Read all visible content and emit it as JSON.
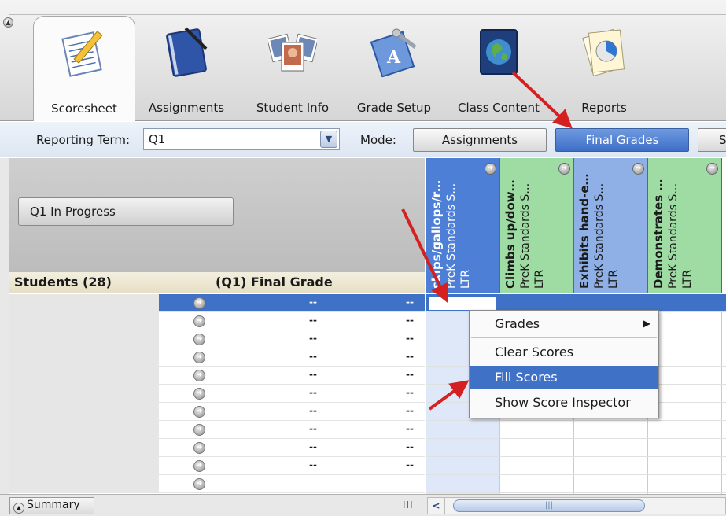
{
  "toolbar": {
    "tabs": [
      {
        "label": "Scoresheet",
        "icon": "scoresheet-icon",
        "active": true
      },
      {
        "label": "Assignments",
        "icon": "assignments-notebook-icon",
        "active": false
      },
      {
        "label": "Student Info",
        "icon": "student-photos-icon",
        "active": false
      },
      {
        "label": "Grade Setup",
        "icon": "grade-setup-icon",
        "active": false
      },
      {
        "label": "Class Content",
        "icon": "globe-book-icon",
        "active": false
      },
      {
        "label": "Reports",
        "icon": "pie-chart-report-icon",
        "active": false
      }
    ]
  },
  "reporting": {
    "label": "Reporting Term:",
    "term_value": "Q1",
    "mode_label": "Mode:",
    "mode_buttons": [
      "Assignments",
      "Final Grades",
      "S"
    ],
    "active_mode": "Final Grades"
  },
  "left_panel": {
    "progress_button": "Q1 In Progress",
    "students_header": "Students (28)",
    "final_grade_header": "(Q1) Final Grade",
    "row_dash": "--"
  },
  "columns": [
    {
      "title": "skips/gallops/r…",
      "subtitle": "PreK Standards S…",
      "type": "LTR",
      "color": "#4e7fd6"
    },
    {
      "title": "Climbs up/dow…",
      "subtitle": "PreK Standards S…",
      "type": "LTR",
      "color": "#9fdca4"
    },
    {
      "title": "Exhibits hand-e…",
      "subtitle": "PreK Standards S…",
      "type": "LTR",
      "color": "#8fb0e6"
    },
    {
      "title": "Demonstrates …",
      "subtitle": "PreK Standards S…",
      "type": "LTR",
      "color": "#9fdca4"
    }
  ],
  "context_menu": {
    "items": [
      "Grades",
      "Clear Scores",
      "Fill Scores",
      "Show Score Inspector"
    ],
    "highlighted": "Fill Scores"
  },
  "bottom": {
    "summary_label": "Summary",
    "scroll_mark": "III"
  },
  "colors": {
    "accent_blue": "#3f72c6",
    "annotation_arrow": "#d42020"
  }
}
